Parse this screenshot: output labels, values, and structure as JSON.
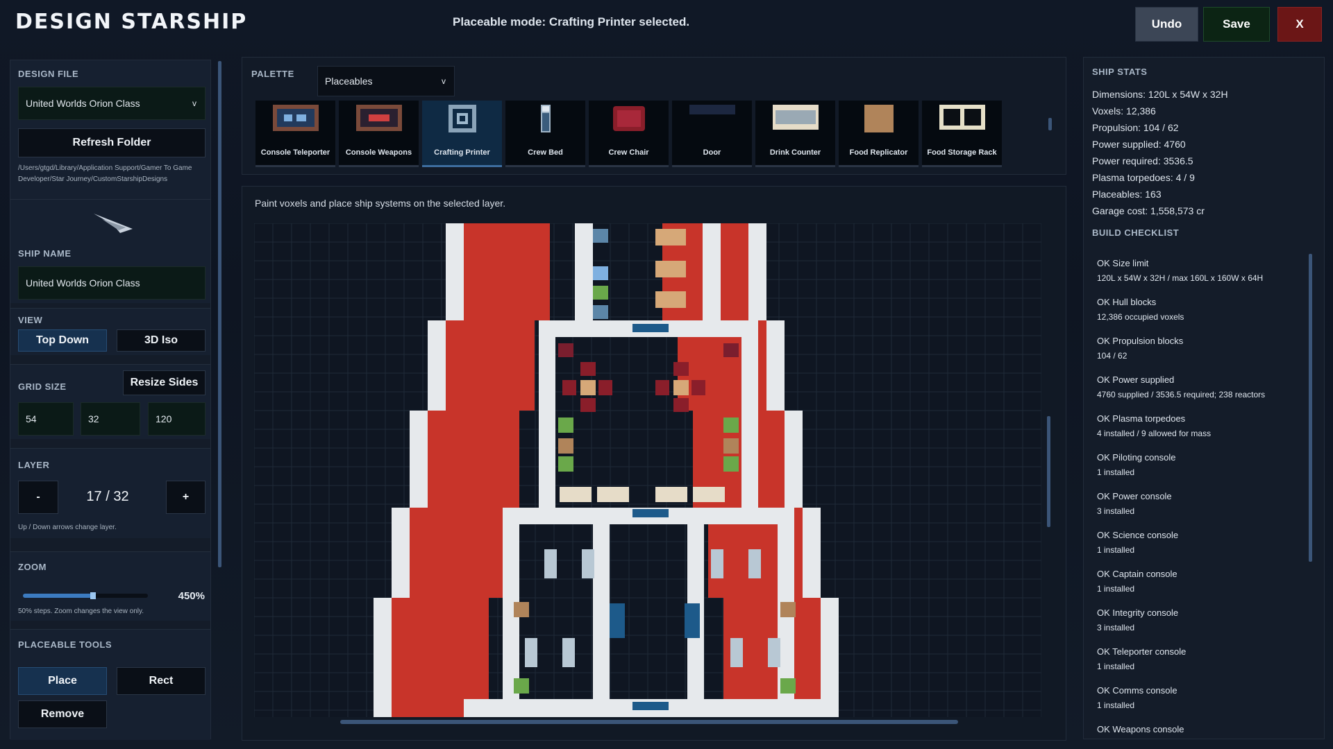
{
  "header": {
    "title": "DESIGN STARSHIP",
    "status": "Placeable mode: Crafting Printer selected.",
    "undo": "Undo",
    "save": "Save",
    "close": "X"
  },
  "left": {
    "design_file_label": "DESIGN FILE",
    "design_file_value": "United Worlds Orion Class",
    "refresh": "Refresh Folder",
    "path": "/Users/gtgd/Library/Application Support/Gamer To Game Developer/Star Journey/CustomStarshipDesigns",
    "ship_name_label": "SHIP NAME",
    "ship_name_value": "United Worlds Orion Class",
    "view_label": "VIEW",
    "view_top": "Top Down",
    "view_iso": "3D Iso",
    "grid_label": "GRID SIZE",
    "resize": "Resize Sides",
    "grid_w": "54",
    "grid_h": "32",
    "grid_l": "120",
    "layer_label": "LAYER",
    "layer_minus": "-",
    "layer_value": "17 / 32",
    "layer_plus": "+",
    "layer_hint": "Up / Down arrows change layer.",
    "zoom_label": "ZOOM",
    "zoom_value": "450%",
    "zoom_fraction": 0.56,
    "zoom_hint": "50% steps. Zoom changes the view only.",
    "tools_label": "PLACEABLE TOOLS",
    "tool_place": "Place",
    "tool_rect": "Rect",
    "tool_remove": "Remove"
  },
  "palette": {
    "label": "PALETTE",
    "dropdown": "Placeables",
    "items": [
      {
        "name": "Console Teleporter",
        "icon": "console-teleporter-icon"
      },
      {
        "name": "Console Weapons",
        "icon": "console-weapons-icon"
      },
      {
        "name": "Crafting Printer",
        "icon": "crafting-printer-icon",
        "selected": true
      },
      {
        "name": "Crew Bed",
        "icon": "crew-bed-icon"
      },
      {
        "name": "Crew Chair",
        "icon": "crew-chair-icon"
      },
      {
        "name": "Door",
        "icon": "door-icon"
      },
      {
        "name": "Drink Counter",
        "icon": "drink-counter-icon"
      },
      {
        "name": "Food Replicator",
        "icon": "food-replicator-icon"
      },
      {
        "name": "Food Storage Rack",
        "icon": "food-storage-rack-icon"
      }
    ]
  },
  "canvas": {
    "hint": "Paint voxels and place ship systems on the selected layer.",
    "colors": {
      "hull": "#c8342a",
      "wall": "#e6e9ec",
      "floor": "#141c28",
      "grid": "#1f2a38"
    }
  },
  "stats": {
    "label": "SHIP STATS",
    "lines": [
      "Dimensions: 120L x 54W x 32H",
      "Voxels: 12,386",
      "Propulsion: 104 / 62",
      "Power supplied: 4760",
      "Power required: 3536.5",
      "Plasma torpedoes: 4 / 9",
      "Placeables: 163",
      "Garage cost: 1,558,573 cr"
    ]
  },
  "checklist": {
    "label": "BUILD CHECKLIST",
    "items": [
      {
        "title": "OK  Size limit",
        "detail": "120L x 54W x 32H / max 160L x 160W x 64H"
      },
      {
        "title": "OK  Hull blocks",
        "detail": "12,386 occupied voxels"
      },
      {
        "title": "OK  Propulsion blocks",
        "detail": "104 / 62"
      },
      {
        "title": "OK  Power supplied",
        "detail": "4760 supplied / 3536.5 required; 238 reactors"
      },
      {
        "title": "OK  Plasma torpedoes",
        "detail": "4 installed / 9 allowed for mass"
      },
      {
        "title": "OK  Piloting console",
        "detail": "1 installed"
      },
      {
        "title": "OK  Power console",
        "detail": "3 installed"
      },
      {
        "title": "OK  Science console",
        "detail": "1 installed"
      },
      {
        "title": "OK  Captain console",
        "detail": "1 installed"
      },
      {
        "title": "OK  Integrity console",
        "detail": "3 installed"
      },
      {
        "title": "OK  Teleporter console",
        "detail": "1 installed"
      },
      {
        "title": "OK  Comms console",
        "detail": "1 installed"
      },
      {
        "title": "OK  Weapons console",
        "detail": ""
      }
    ]
  }
}
